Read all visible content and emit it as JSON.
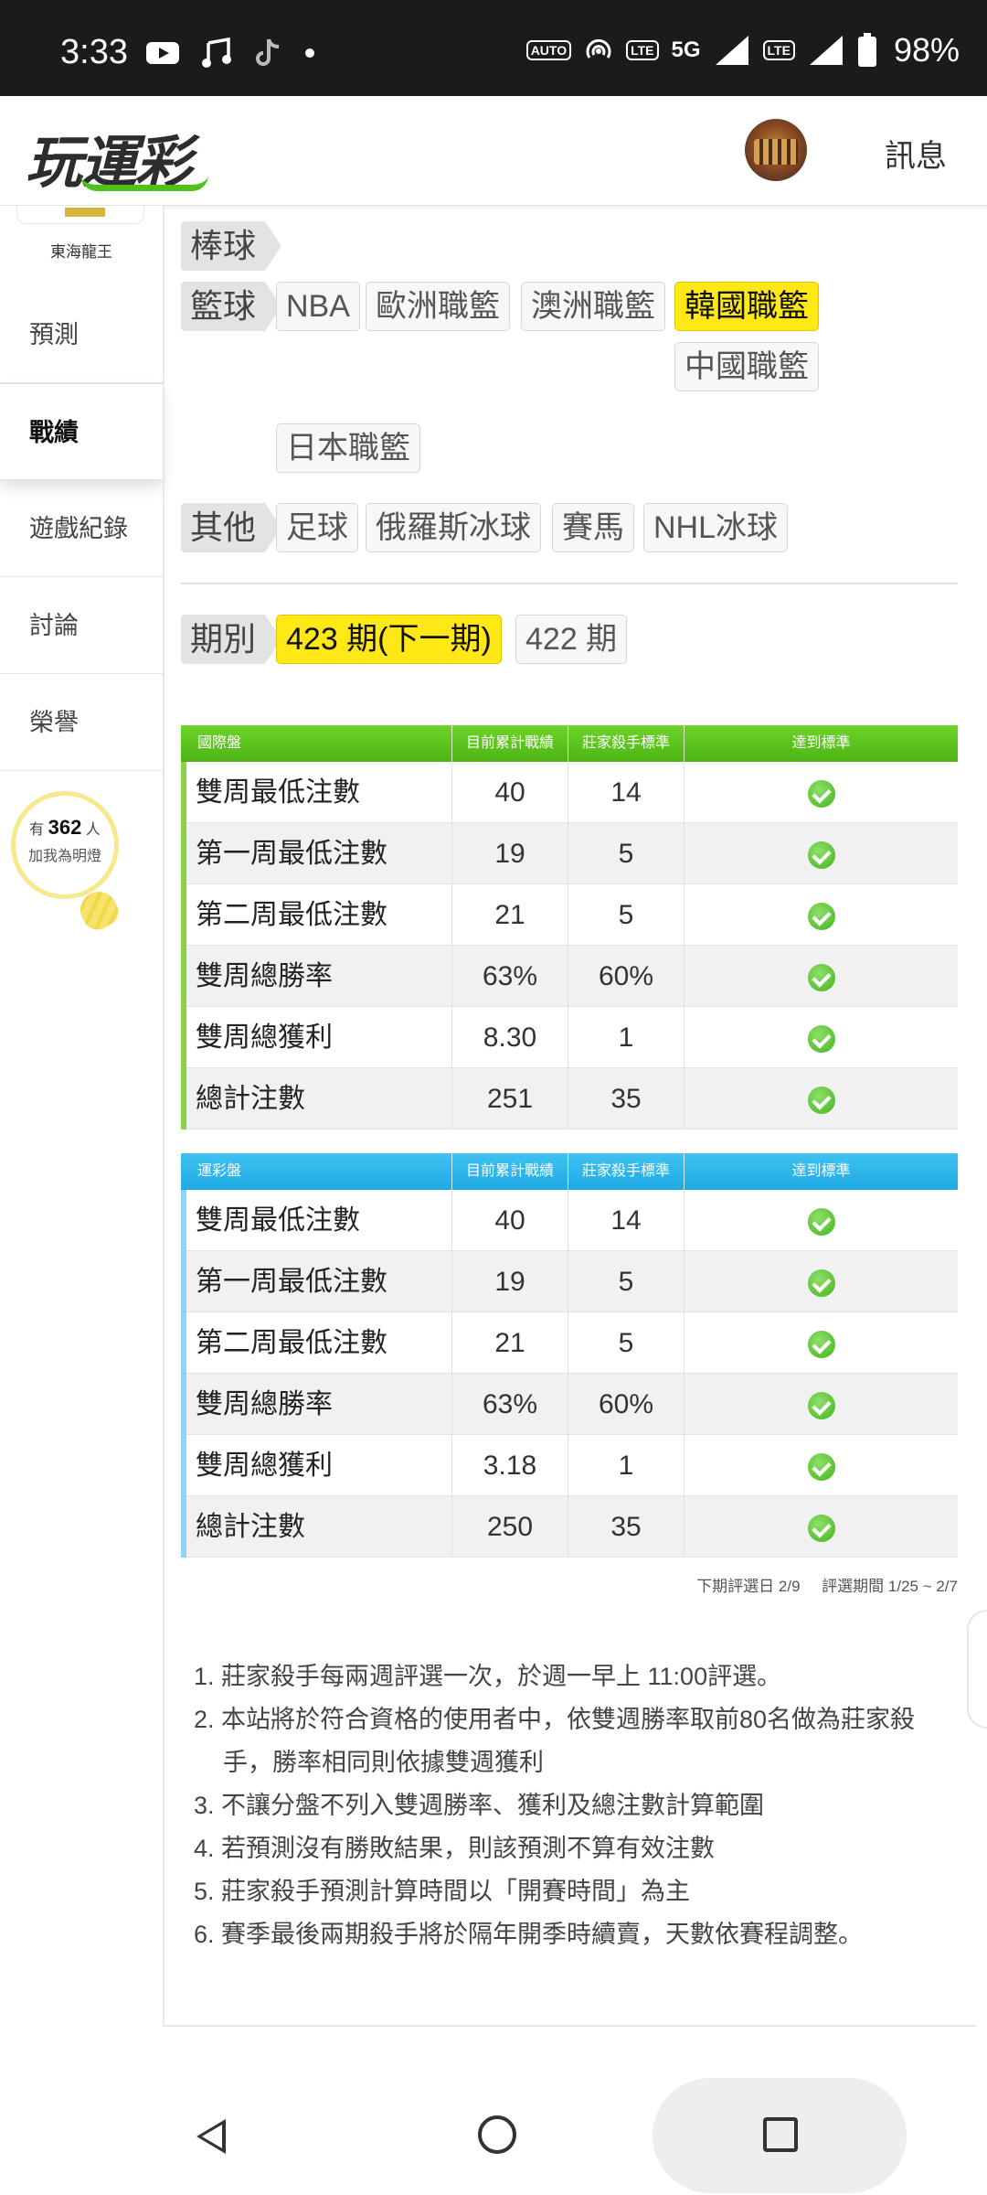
{
  "status_bar": {
    "time": "3:33",
    "network": "5G",
    "sim1": "1",
    "sim2": "2",
    "battery": "98%",
    "icons": [
      "youtube-icon",
      "music-icon",
      "tiktok-icon",
      "dot-icon",
      "auto-hz-icon",
      "hotspot-icon",
      "volte-icon",
      "signal-icon",
      "battery-icon"
    ]
  },
  "header": {
    "logo": "玩運彩",
    "messages_label": "訊息"
  },
  "sidebar": {
    "user_name": "東海龍王",
    "items": [
      {
        "label": "預測"
      },
      {
        "label": "戰績"
      },
      {
        "label": "遊戲紀錄"
      },
      {
        "label": "討論"
      },
      {
        "label": "榮譽"
      }
    ],
    "bulb_prefix": "有",
    "bulb_count": "362",
    "bulb_suffix": "人",
    "bulb_cta": "加我為明燈"
  },
  "categories": {
    "baseball": {
      "label": "棒球"
    },
    "basketball": {
      "label": "籃球",
      "leagues": [
        "NBA",
        "歐洲職籃",
        "澳洲職籃",
        "韓國職籃",
        "中國職籃",
        "日本職籃"
      ],
      "selected": "韓國職籃"
    },
    "other": {
      "label": "其他",
      "leagues": [
        "足球",
        "俄羅斯冰球",
        "賽馬",
        "NHL冰球"
      ]
    }
  },
  "periods": {
    "label": "期別",
    "options": [
      "423 期(下一期)",
      "422 期"
    ],
    "selected": "423 期(下一期)"
  },
  "table_headers": {
    "current": "目前累計戰績",
    "standard": "莊家殺手標準",
    "achieved": "達到標準"
  },
  "intl_table": {
    "title": "國際盤",
    "rows": [
      {
        "label": "雙周最低注數",
        "current": "40",
        "standard": "14",
        "met": true
      },
      {
        "label": "第一周最低注數",
        "current": "19",
        "standard": "5",
        "met": true
      },
      {
        "label": "第二周最低注數",
        "current": "21",
        "standard": "5",
        "met": true
      },
      {
        "label": "雙周總勝率",
        "current": "63%",
        "standard": "60%",
        "met": true
      },
      {
        "label": "雙周總獲利",
        "current": "8.30",
        "standard": "1",
        "met": true
      },
      {
        "label": "總計注數",
        "current": "251",
        "standard": "35",
        "met": true
      }
    ]
  },
  "lottery_table": {
    "title": "運彩盤",
    "rows": [
      {
        "label": "雙周最低注數",
        "current": "40",
        "standard": "14",
        "met": true
      },
      {
        "label": "第一周最低注數",
        "current": "19",
        "standard": "5",
        "met": true
      },
      {
        "label": "第二周最低注數",
        "current": "21",
        "standard": "5",
        "met": true
      },
      {
        "label": "雙周總勝率",
        "current": "63%",
        "standard": "60%",
        "met": true
      },
      {
        "label": "雙周總獲利",
        "current": "3.18",
        "standard": "1",
        "met": true
      },
      {
        "label": "總計注數",
        "current": "250",
        "standard": "35",
        "met": true
      }
    ]
  },
  "evaluation": {
    "next_date": "下期評選日 2/9",
    "period": "評選期間 1/25 ~ 2/7"
  },
  "notes": [
    "1. 莊家殺手每兩週評選一次，於週一早上 11:00評選。",
    "2. 本站將於符合資格的使用者中，依雙週勝率取前80名做為莊家殺手，勝率相同則依據雙週獲利",
    "3. 不讓分盤不列入雙週勝率、獲利及總注數計算範圍",
    "4. 若預測沒有勝敗結果，則該預測不算有效注數",
    "5. 莊家殺手預測計算時間以「開賽時間」為主",
    "6. 賽季最後兩期殺手將於隔年開季時續賣，天數依賽程調整。"
  ],
  "colors": {
    "accent_yellow": "#ffe816",
    "intl_header": "#4cb414",
    "lottery_header": "#1fa9e3",
    "check_green": "#43b41b"
  }
}
